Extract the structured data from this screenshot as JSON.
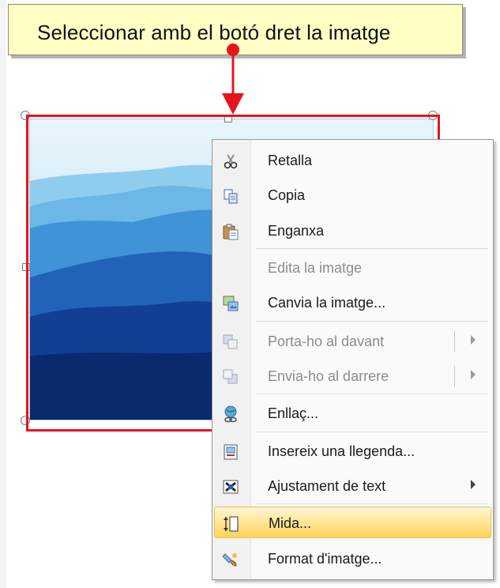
{
  "callout": {
    "text": "Seleccionar amb el botó dret la imatge"
  },
  "menu": {
    "items": [
      {
        "label": "Retalla",
        "icon": "scissors-icon",
        "enabled": true
      },
      {
        "label": "Copia",
        "icon": "copy-icon",
        "enabled": true
      },
      {
        "label": "Enganxa",
        "icon": "paste-icon",
        "enabled": true
      },
      {
        "label": "Edita la imatge",
        "icon": "",
        "enabled": false
      },
      {
        "label": "Canvia la imatge...",
        "icon": "change-picture-icon",
        "enabled": true
      },
      {
        "label": "Porta-ho al davant",
        "icon": "bring-to-front-icon",
        "enabled": false,
        "submenu": true
      },
      {
        "label": "Envia-ho al darrere",
        "icon": "send-to-back-icon",
        "enabled": false,
        "submenu": true
      },
      {
        "label": "Enllaç...",
        "icon": "hyperlink-icon",
        "enabled": true
      },
      {
        "label": "Insereix una llegenda...",
        "icon": "insert-caption-icon",
        "enabled": true
      },
      {
        "label": "Ajustament de text",
        "icon": "text-wrapping-icon",
        "enabled": true,
        "submenu": true
      },
      {
        "label": "Mida...",
        "icon": "size-icon",
        "enabled": true,
        "highlighted": true
      },
      {
        "label": "Format d'imatge...",
        "icon": "format-picture-icon",
        "enabled": true
      }
    ]
  },
  "colors": {
    "highlight_box": "#e8141c",
    "callout_bg": "#ffffc6",
    "menu_highlight": "#ffe38f"
  }
}
